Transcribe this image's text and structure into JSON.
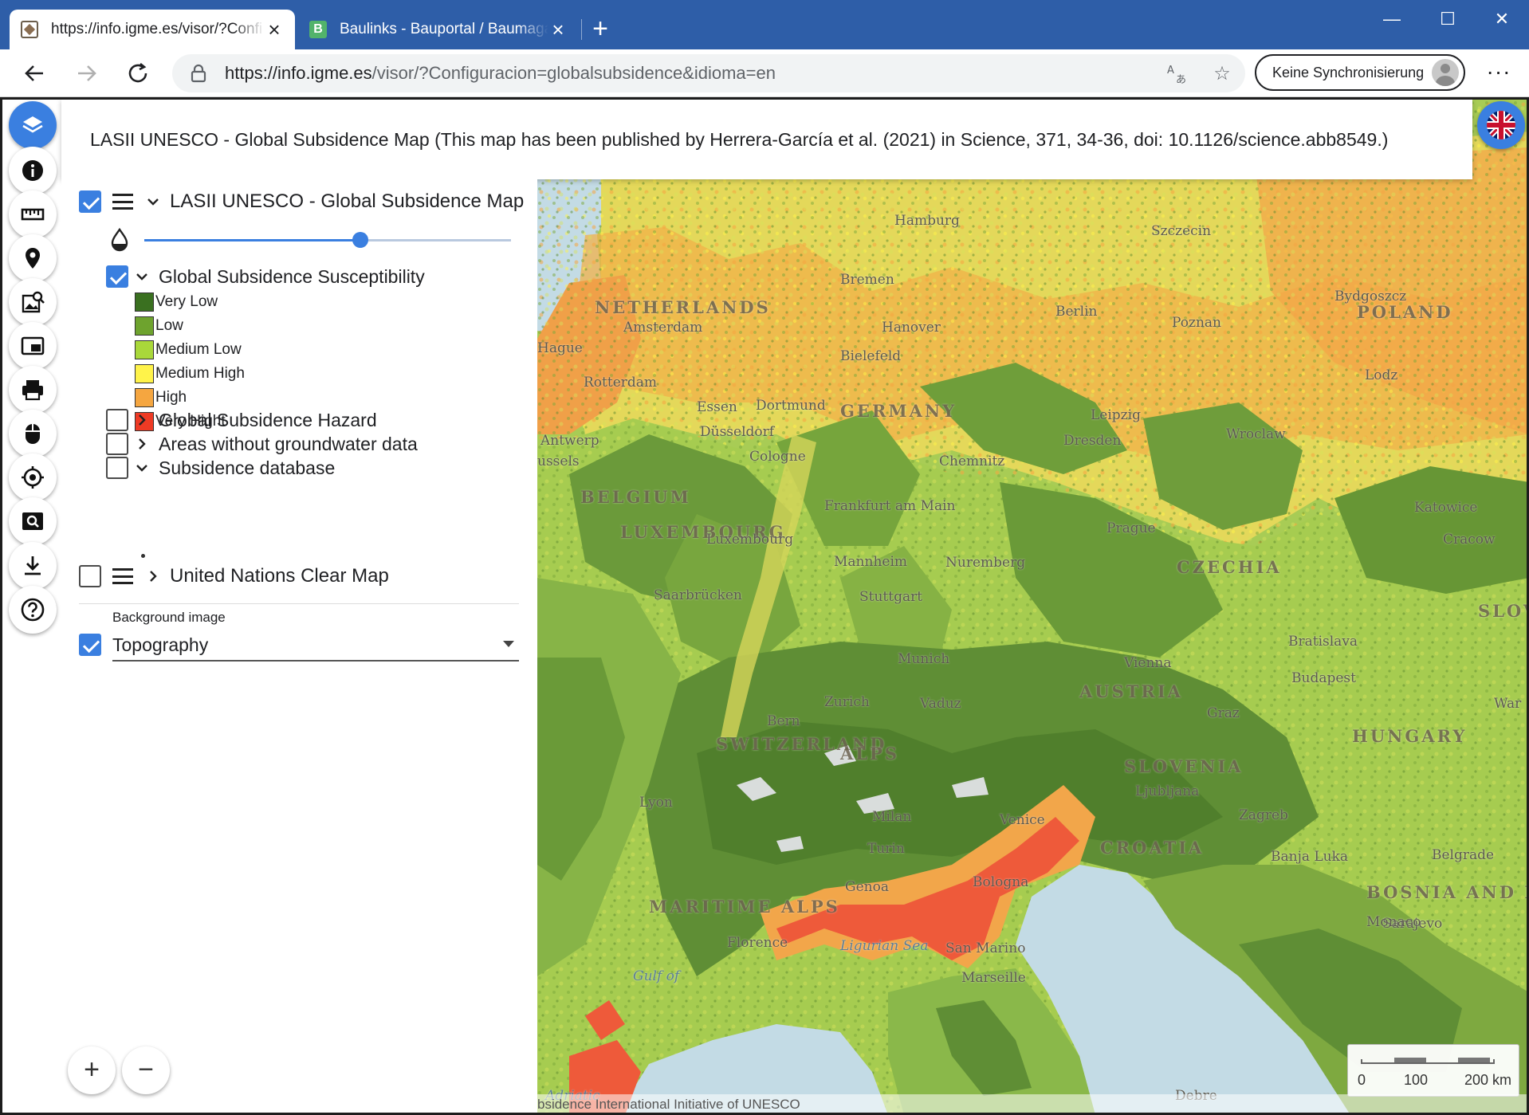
{
  "browser": {
    "tabs": [
      {
        "title": "https://info.igme.es/visor/?Confi",
        "favicon": "igme-favicon",
        "active": true
      },
      {
        "title": "Baulinks - Bauportal / Baumagaz",
        "favicon": "baulinks-favicon",
        "active": false
      }
    ],
    "new_tab_label": "+",
    "url_host": "https://info.igme.es",
    "url_path": "/visor/?Configuracion=globalsubsidence&idioma=en",
    "sync_label": "Keine Synchronisierung",
    "more_label": "···",
    "titlebar_color": "#2e5ea8"
  },
  "header": {
    "title": "LASII UNESCO - Global Subsidence Map (This map has been published by Herrera-García et al. (2021) in Science, 371, 34-36, doi: 10.1126/science.abb8549.)"
  },
  "tools": [
    {
      "name": "layers-icon",
      "active": true
    },
    {
      "name": "info-icon",
      "active": false
    },
    {
      "name": "ruler-icon",
      "active": false
    },
    {
      "name": "location-pin-icon",
      "active": false
    },
    {
      "name": "image-search-icon",
      "active": false
    },
    {
      "name": "picture-in-picture-icon",
      "active": false
    },
    {
      "name": "print-icon",
      "active": false
    },
    {
      "name": "mouse-icon",
      "active": false
    },
    {
      "name": "crosshair-icon",
      "active": false
    },
    {
      "name": "zoom-search-icon",
      "active": false
    },
    {
      "name": "download-icon",
      "active": false
    },
    {
      "name": "help-icon",
      "active": false
    }
  ],
  "layers": {
    "main": {
      "label": "LASII UNESCO - Global Subsidence Map",
      "checked": true,
      "expanded": true,
      "opacity": 0.59
    },
    "susceptibility": {
      "label": "Global Subsidence Susceptibility",
      "checked": true,
      "expanded": true
    },
    "legend": [
      {
        "label": "Very Low",
        "color": "#3a7020"
      },
      {
        "label": "Low",
        "color": "#6ea32e"
      },
      {
        "label": "Medium Low",
        "color": "#a9d83a"
      },
      {
        "label": "Medium High",
        "color": "#fff34a"
      },
      {
        "label": "High",
        "color": "#f5a640"
      },
      {
        "label": "Very Hight",
        "color": "#ee3a24"
      }
    ],
    "hazard": {
      "label": "Global Subsidence Hazard",
      "checked": false,
      "expanded": false
    },
    "groundwater": {
      "label": "Areas without groundwater data",
      "checked": false,
      "expanded": false
    },
    "database": {
      "label": "Subsidence database",
      "checked": false,
      "expanded": true
    },
    "un_map": {
      "label": "United Nations Clear Map",
      "checked": false,
      "expanded": false
    }
  },
  "background": {
    "label": "Background image",
    "value": "Topography",
    "checked": true
  },
  "zoom": {
    "in_label": "+",
    "out_label": "−"
  },
  "map": {
    "labels": [
      {
        "text": "Hamburg",
        "type": "city"
      },
      {
        "text": "Szczecin",
        "type": "city"
      },
      {
        "text": "Bremen",
        "type": "city"
      },
      {
        "text": "Bydgoszcz",
        "type": "city"
      },
      {
        "text": "NETHERLANDS",
        "type": "country"
      },
      {
        "text": "Amsterdam",
        "type": "city"
      },
      {
        "text": "Hanover",
        "type": "city"
      },
      {
        "text": "Berlin",
        "type": "city"
      },
      {
        "text": "Poznan",
        "type": "city"
      },
      {
        "text": "POLAND",
        "type": "country"
      },
      {
        "text": "Hague",
        "type": "city"
      },
      {
        "text": "Bielefeld",
        "type": "city"
      },
      {
        "text": "Rotterdam",
        "type": "city"
      },
      {
        "text": "Essen",
        "type": "city"
      },
      {
        "text": "Dortmund",
        "type": "city"
      },
      {
        "text": "Lodz",
        "type": "city"
      },
      {
        "text": "GERMANY",
        "type": "country"
      },
      {
        "text": "Leipzig",
        "type": "city"
      },
      {
        "text": "Düsseldorf",
        "type": "city"
      },
      {
        "text": "Wroclaw",
        "type": "city"
      },
      {
        "text": "Antwerp",
        "type": "city"
      },
      {
        "text": "Cologne",
        "type": "city"
      },
      {
        "text": "Dresden",
        "type": "city"
      },
      {
        "text": "ussels",
        "type": "city"
      },
      {
        "text": "Chemnitz",
        "type": "city"
      },
      {
        "text": "BELGIUM",
        "type": "country"
      },
      {
        "text": "Frankfurt am Main",
        "type": "city"
      },
      {
        "text": "Katowice",
        "type": "city"
      },
      {
        "text": "Prague",
        "type": "city"
      },
      {
        "text": "Cracow",
        "type": "city"
      },
      {
        "text": "LUXEMBOURG",
        "type": "country"
      },
      {
        "text": "Luxembourg",
        "type": "city"
      },
      {
        "text": "CZECHIA",
        "type": "country"
      },
      {
        "text": "Mannheim",
        "type": "city"
      },
      {
        "text": "Nuremberg",
        "type": "city"
      },
      {
        "text": "Saarbrücken",
        "type": "city"
      },
      {
        "text": "Stuttgart",
        "type": "city"
      },
      {
        "text": "SLOVAKIA",
        "type": "country"
      },
      {
        "text": "Bratislava",
        "type": "city"
      },
      {
        "text": "Munich",
        "type": "city"
      },
      {
        "text": "Vienna",
        "type": "city"
      },
      {
        "text": "Budapest",
        "type": "city"
      },
      {
        "text": "Zurich",
        "type": "city"
      },
      {
        "text": "Vaduz",
        "type": "city"
      },
      {
        "text": "AUSTRIA",
        "type": "country"
      },
      {
        "text": "Graz",
        "type": "city"
      },
      {
        "text": "Bern",
        "type": "city"
      },
      {
        "text": "SWITZERLAND",
        "type": "country"
      },
      {
        "text": "HUNGARY",
        "type": "country"
      },
      {
        "text": "ALPS",
        "type": "country"
      },
      {
        "text": "SLOVENIA",
        "type": "country"
      },
      {
        "text": "Ljubljana",
        "type": "city"
      },
      {
        "text": "Lyon",
        "type": "city"
      },
      {
        "text": "Milan",
        "type": "city"
      },
      {
        "text": "Venice",
        "type": "city"
      },
      {
        "text": "Zagreb",
        "type": "city"
      },
      {
        "text": "Turin",
        "type": "city"
      },
      {
        "text": "CROATIA",
        "type": "country"
      },
      {
        "text": "Belgrade",
        "type": "city"
      },
      {
        "text": "Banja Luka",
        "type": "city"
      },
      {
        "text": "Bologna",
        "type": "city"
      },
      {
        "text": "Genoa",
        "type": "city"
      },
      {
        "text": "BOSNIA AND HERZEGOVINA",
        "type": "country"
      },
      {
        "text": "Sarajevo",
        "type": "city"
      },
      {
        "text": "MARITIME ALPS",
        "type": "country"
      },
      {
        "text": "Ligurian Sea",
        "type": "sea"
      },
      {
        "text": "San Marino",
        "type": "city"
      },
      {
        "text": "Monaco",
        "type": "city"
      },
      {
        "text": "Florence",
        "type": "city"
      },
      {
        "text": "Marseille",
        "type": "city"
      },
      {
        "text": "Gulf of",
        "type": "sea"
      },
      {
        "text": "Adriatic",
        "type": "sea"
      },
      {
        "text": "Debre",
        "type": "city"
      },
      {
        "text": "War",
        "type": "city"
      }
    ],
    "scale": {
      "zero": "0",
      "mid": "100",
      "end": "200 km"
    },
    "attribution": "bsidence International Initiative of UNESCO"
  }
}
